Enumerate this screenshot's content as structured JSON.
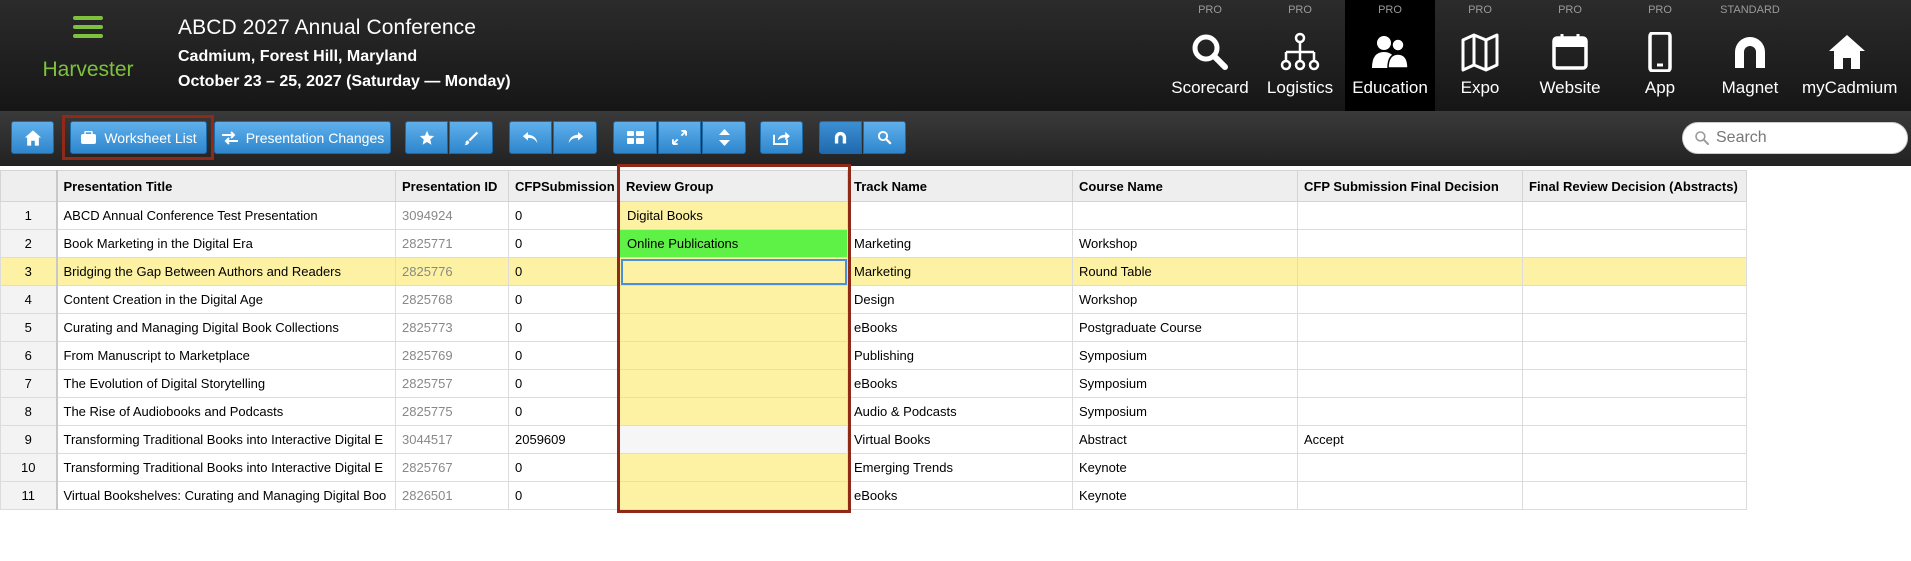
{
  "header": {
    "brand": "Harvester",
    "conference_title": "ABCD 2027 Annual Conference",
    "conference_location": "Cadmium, Forest Hill, Maryland",
    "conference_dates": "October 23 – 25, 2027 (Saturday — Monday)",
    "modules": [
      {
        "tier": "PRO",
        "label": "Scorecard",
        "icon": "search-icon",
        "active": false
      },
      {
        "tier": "PRO",
        "label": "Logistics",
        "icon": "org-chart-icon",
        "active": false
      },
      {
        "tier": "PRO",
        "label": "Education",
        "icon": "users-icon",
        "active": true
      },
      {
        "tier": "PRO",
        "label": "Expo",
        "icon": "map-icon",
        "active": false
      },
      {
        "tier": "PRO",
        "label": "Website",
        "icon": "browser-icon",
        "active": false
      },
      {
        "tier": "PRO",
        "label": "App",
        "icon": "phone-icon",
        "active": false
      },
      {
        "tier": "STANDARD",
        "label": "Magnet",
        "icon": "magnet-icon",
        "active": false
      },
      {
        "tier": "",
        "label": "myCadmium",
        "icon": "home-icon",
        "active": false
      }
    ]
  },
  "toolbar": {
    "home_icon": "home-icon",
    "worksheet_list_label": "Worksheet List",
    "presentation_changes_label": "Presentation Changes",
    "search_placeholder": "Search"
  },
  "grid": {
    "columns": [
      "Presentation Title",
      "Presentation ID",
      "CFPSubmission",
      "Review Group",
      "Track Name",
      "Course Name",
      "CFP Submission Final Decision",
      "Final Review Decision (Abstracts)"
    ],
    "rows": [
      {
        "n": "1",
        "title": "ABCD Annual Conference Test Presentation",
        "id": "3094924",
        "cfp": "0",
        "group": "Digital Books",
        "track": "",
        "course": "",
        "decision": "",
        "final": ""
      },
      {
        "n": "2",
        "title": "Book Marketing in the Digital Era",
        "id": "2825771",
        "cfp": "0",
        "group": "Online Publications",
        "track": "Marketing",
        "course": "Workshop",
        "decision": "",
        "final": ""
      },
      {
        "n": "3",
        "title": "Bridging the Gap Between Authors and Readers",
        "id": "2825776",
        "cfp": "0",
        "group": "",
        "track": "Marketing",
        "course": "Round Table",
        "decision": "",
        "final": ""
      },
      {
        "n": "4",
        "title": "Content Creation in the Digital Age",
        "id": "2825768",
        "cfp": "0",
        "group": "",
        "track": "Design",
        "course": "Workshop",
        "decision": "",
        "final": ""
      },
      {
        "n": "5",
        "title": "Curating and Managing Digital Book Collections",
        "id": "2825773",
        "cfp": "0",
        "group": "",
        "track": "eBooks",
        "course": "Postgraduate Course",
        "decision": "",
        "final": ""
      },
      {
        "n": "6",
        "title": "From Manuscript to Marketplace",
        "id": "2825769",
        "cfp": "0",
        "group": "",
        "track": "Publishing",
        "course": "Symposium",
        "decision": "",
        "final": ""
      },
      {
        "n": "7",
        "title": "The Evolution of Digital Storytelling",
        "id": "2825757",
        "cfp": "0",
        "group": "",
        "track": "eBooks",
        "course": "Symposium",
        "decision": "",
        "final": ""
      },
      {
        "n": "8",
        "title": "The Rise of Audiobooks and Podcasts",
        "id": "2825775",
        "cfp": "0",
        "group": "",
        "track": "Audio & Podcasts",
        "course": "Symposium",
        "decision": "",
        "final": ""
      },
      {
        "n": "9",
        "title": "Transforming Traditional Books into Interactive Digital E",
        "id": "3044517",
        "cfp": "2059609",
        "group": "",
        "track": "Virtual Books",
        "course": "Abstract",
        "decision": "Accept",
        "final": ""
      },
      {
        "n": "10",
        "title": "Transforming Traditional Books into Interactive Digital E",
        "id": "2825767",
        "cfp": "0",
        "group": "",
        "track": "Emerging Trends",
        "course": "Keynote",
        "decision": "",
        "final": ""
      },
      {
        "n": "11",
        "title": "Virtual Bookshelves: Curating and Managing Digital Boo",
        "id": "2826501",
        "cfp": "0",
        "group": "",
        "track": "eBooks",
        "course": "Keynote",
        "decision": "",
        "final": ""
      }
    ]
  },
  "colors": {
    "accent_green": "#7ec13d",
    "button_blue": "#3a92d8",
    "highlight_red": "#8e2a17",
    "review_yellow": "#fdf2a3",
    "review_green": "#5ef246"
  }
}
